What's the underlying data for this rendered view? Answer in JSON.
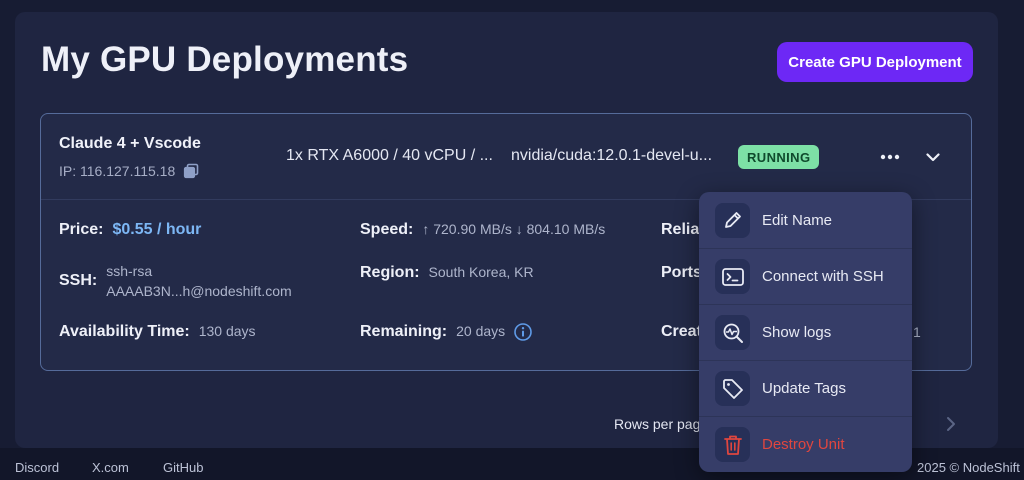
{
  "page": {
    "title": "My GPU Deployments"
  },
  "toolbar": {
    "create_label": "Create GPU Deployment"
  },
  "deployment": {
    "name": "Claude 4 + Vscode",
    "ip": "IP: 116.127.115.18",
    "gpu_spec": "1x RTX A6000 / 40 vCPU / ...",
    "image": "nvidia/cuda:12.0.1-devel-u...",
    "status": "RUNNING",
    "details": {
      "price_label": "Price:",
      "price_value": "$0.55 / hour",
      "speed_label": "Speed:",
      "speed_value": "↑ 720.90 MB/s ↓ 804.10 MB/s",
      "reliability_label_partial": "Relia",
      "ssh_label": "SSH:",
      "ssh_line1": "ssh-rsa",
      "ssh_line2": "AAAAB3N...h@nodeshift.com",
      "region_label": "Region:",
      "region_value": "South Korea, KR",
      "ports_label_partial": "Ports",
      "availability_label": "Availability Time:",
      "availability_value": "130 days",
      "remaining_label": "Remaining:",
      "remaining_value": "20 days",
      "created_label_partial": "Creat",
      "created_value_partial": "1"
    }
  },
  "menu": {
    "items": [
      {
        "label": "Edit Name",
        "icon": "pencil-icon"
      },
      {
        "label": "Connect with SSH",
        "icon": "terminal-icon"
      },
      {
        "label": "Show logs",
        "icon": "logs-search-icon"
      },
      {
        "label": "Update Tags",
        "icon": "tag-icon"
      },
      {
        "label": "Destroy Unit",
        "icon": "trash-icon",
        "danger": true
      }
    ]
  },
  "pagination": {
    "rows_per_page_partial": "Rows per pag"
  },
  "footer": {
    "links": [
      "Discord",
      "X.com",
      "GitHub"
    ],
    "copyright": "2025 © NodeShift"
  },
  "colors": {
    "background": "#171c33",
    "panel": "#1f2541",
    "accent": "#6d28f5",
    "price": "#7db7f5",
    "status_running": "#7de0a6",
    "danger": "#e0463f",
    "menu": "#363d68"
  }
}
